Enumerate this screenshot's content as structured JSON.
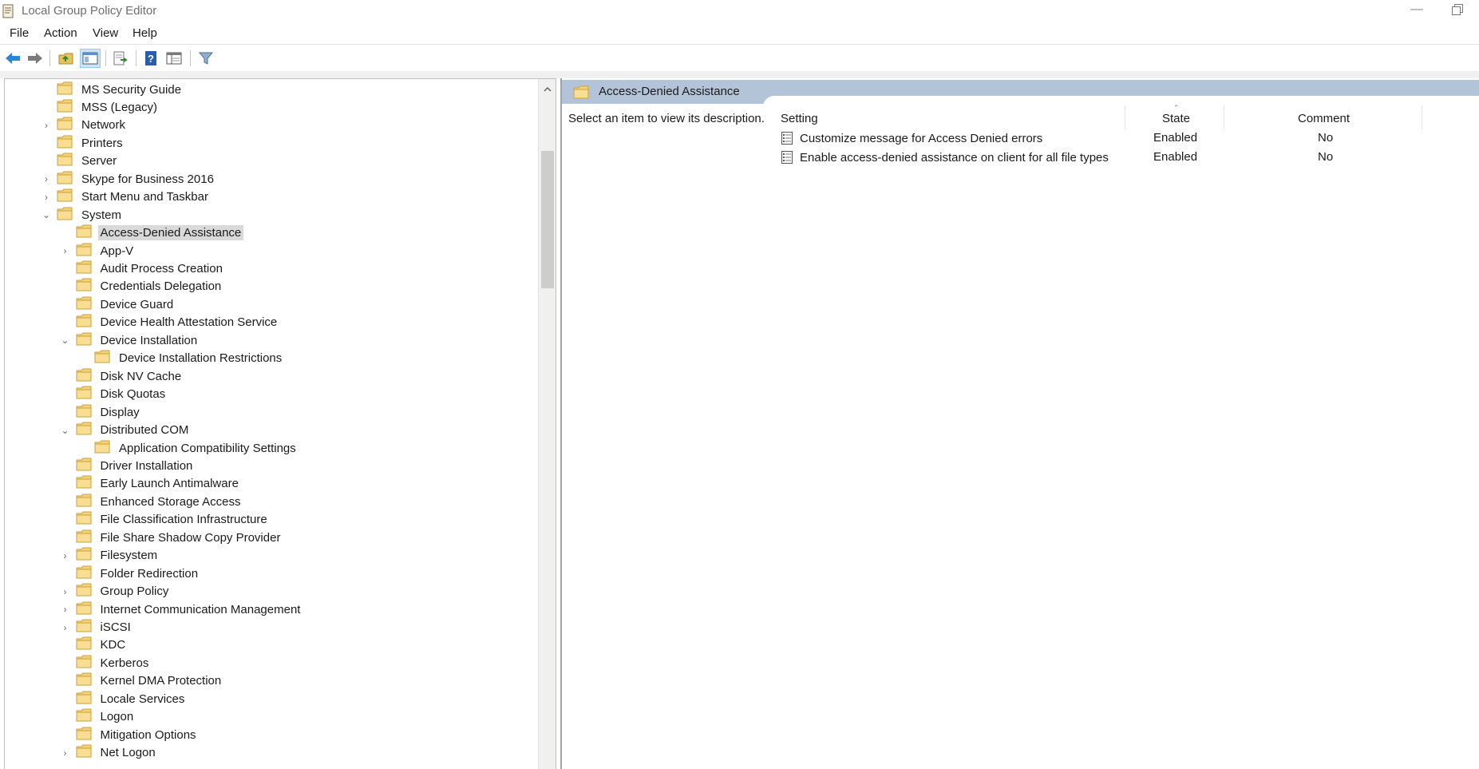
{
  "window": {
    "title": "Local Group Policy Editor"
  },
  "menu": {
    "file": {
      "label": "File"
    },
    "action": {
      "label": "Action"
    },
    "view": {
      "label": "View"
    },
    "help": {
      "label": "Help"
    }
  },
  "toolbar": {
    "buttons": [
      "back-arrow-icon",
      "forward-arrow-icon",
      "up-folder-icon",
      "show-hide-tree-icon",
      "export-list-icon",
      "help-icon",
      "properties-icon",
      "filter-icon"
    ],
    "pressed": "show-hide-tree-icon"
  },
  "tree": {
    "items": [
      {
        "label": "MS Security Guide",
        "expander": ""
      },
      {
        "label": "MSS (Legacy)",
        "expander": ""
      },
      {
        "label": "Network",
        "expander": "›"
      },
      {
        "label": "Printers",
        "expander": ""
      },
      {
        "label": "Server",
        "expander": ""
      },
      {
        "label": "Skype for Business 2016",
        "expander": "›"
      },
      {
        "label": "Start Menu and Taskbar",
        "expander": "›"
      },
      {
        "label": "System",
        "expander": "⌄"
      },
      {
        "label": "Access-Denied Assistance",
        "expander": "",
        "selected": true
      },
      {
        "label": "App-V",
        "expander": "›"
      },
      {
        "label": "Audit Process Creation",
        "expander": ""
      },
      {
        "label": "Credentials Delegation",
        "expander": ""
      },
      {
        "label": "Device Guard",
        "expander": ""
      },
      {
        "label": "Device Health Attestation Service",
        "expander": ""
      },
      {
        "label": "Device Installation",
        "expander": "⌄"
      },
      {
        "label": "Device Installation Restrictions",
        "expander": ""
      },
      {
        "label": "Disk NV Cache",
        "expander": ""
      },
      {
        "label": "Disk Quotas",
        "expander": ""
      },
      {
        "label": "Display",
        "expander": ""
      },
      {
        "label": "Distributed COM",
        "expander": "⌄"
      },
      {
        "label": "Application Compatibility Settings",
        "expander": ""
      },
      {
        "label": "Driver Installation",
        "expander": ""
      },
      {
        "label": "Early Launch Antimalware",
        "expander": ""
      },
      {
        "label": "Enhanced Storage Access",
        "expander": ""
      },
      {
        "label": "File Classification Infrastructure",
        "expander": ""
      },
      {
        "label": "File Share Shadow Copy Provider",
        "expander": ""
      },
      {
        "label": "Filesystem",
        "expander": "›"
      },
      {
        "label": "Folder Redirection",
        "expander": ""
      },
      {
        "label": "Group Policy",
        "expander": "›"
      },
      {
        "label": "Internet Communication Management",
        "expander": "›"
      },
      {
        "label": "iSCSI",
        "expander": "›"
      },
      {
        "label": "KDC",
        "expander": ""
      },
      {
        "label": "Kerberos",
        "expander": ""
      },
      {
        "label": "Kernel DMA Protection",
        "expander": ""
      },
      {
        "label": "Locale Services",
        "expander": ""
      },
      {
        "label": "Logon",
        "expander": ""
      },
      {
        "label": "Mitigation Options",
        "expander": ""
      },
      {
        "label": "Net Logon",
        "expander": "›"
      }
    ]
  },
  "details": {
    "title": "Access-Denied Assistance",
    "description": "Select an item to view its description.",
    "columns": {
      "setting": "Setting",
      "state": "State",
      "comment": "Comment"
    },
    "rows": [
      {
        "setting": "Customize message for Access Denied errors",
        "state": "Enabled",
        "comment": "No"
      },
      {
        "setting": "Enable access-denied assistance on client for all file types",
        "state": "Enabled",
        "comment": "No"
      }
    ]
  },
  "colors": {
    "header_band": "#b4c4d8",
    "folder": "#f5d27a",
    "selected_bg": "#d9d9d9",
    "toolbar_pressed": "#cce4f7"
  }
}
